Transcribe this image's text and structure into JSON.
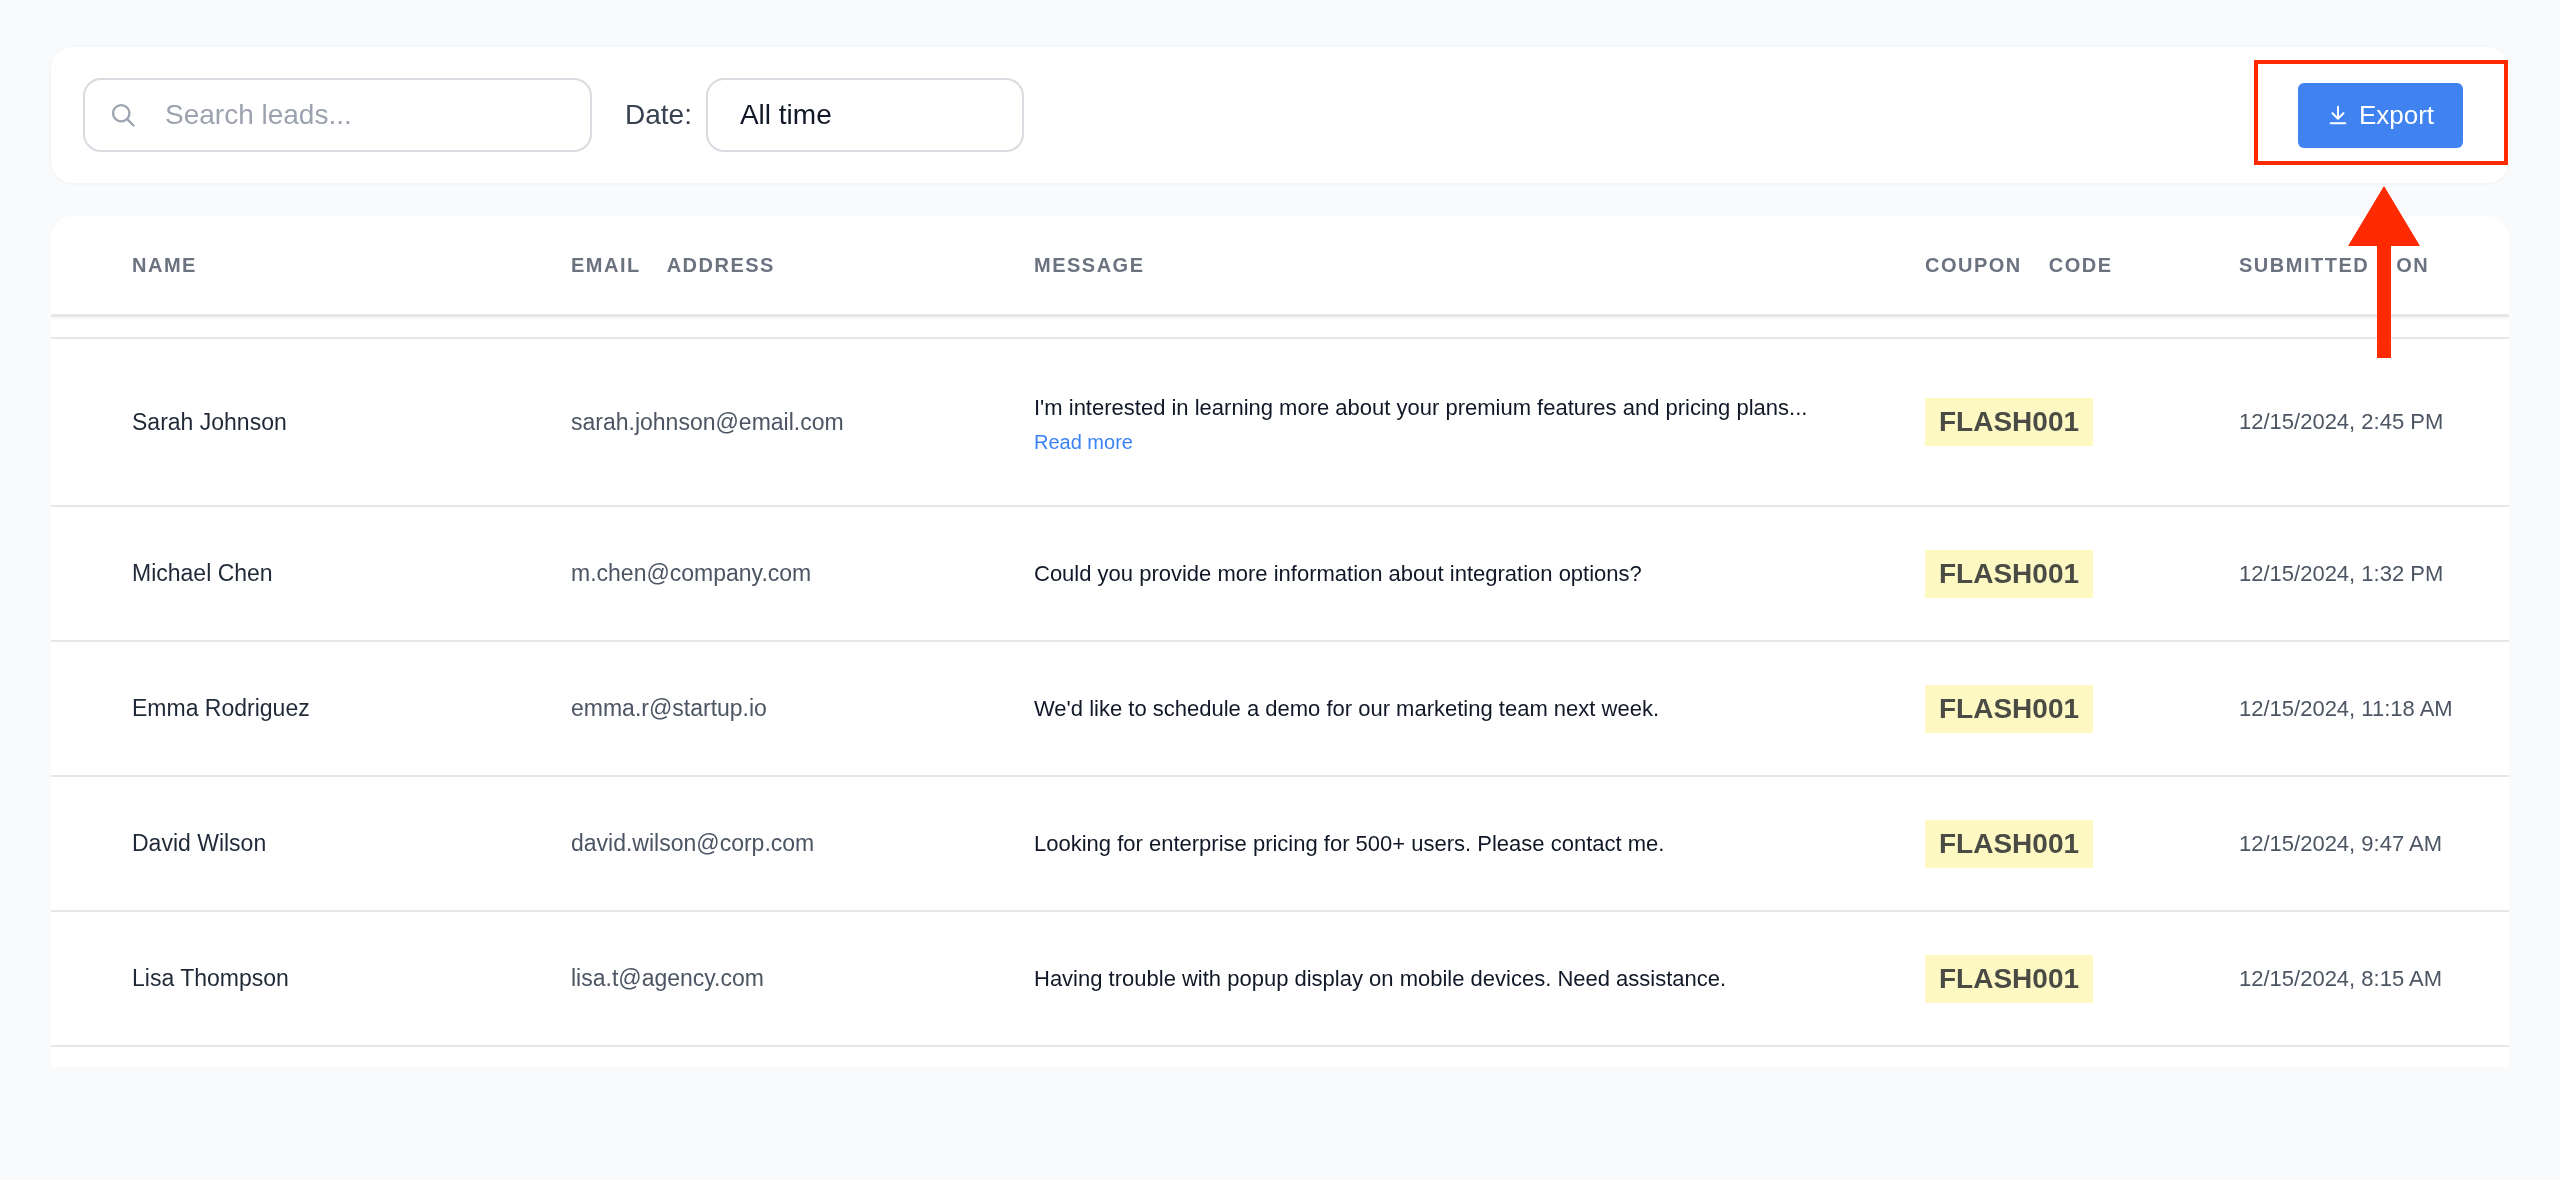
{
  "toolbar": {
    "search": {
      "placeholder": "Search leads..."
    },
    "date_filter": {
      "label": "Date:",
      "value": "All time"
    },
    "export_button": {
      "label": "Export"
    }
  },
  "table": {
    "columns": [
      "NAME",
      "EMAIL ADDRESS",
      "MESSAGE",
      "COUPON CODE",
      "SUBMITTED ON"
    ],
    "rows": [
      {
        "name": "Sarah Johnson",
        "email": "sarah.johnson@email.com",
        "message": "I'm interested in learning more about your premium features and pricing plans...",
        "read_more": "Read more",
        "coupon": "FLASH001",
        "submitted": "12/15/2024, 2:45 PM"
      },
      {
        "name": "Michael Chen",
        "email": "m.chen@company.com",
        "message": "Could you provide more information about integration options?",
        "coupon": "FLASH001",
        "submitted": "12/15/2024, 1:32 PM"
      },
      {
        "name": "Emma Rodriguez",
        "email": "emma.r@startup.io",
        "message": "We'd like to schedule a demo for our marketing team next week.",
        "coupon": "FLASH001",
        "submitted": "12/15/2024, 11:18 AM"
      },
      {
        "name": "David Wilson",
        "email": "david.wilson@corp.com",
        "message": "Looking for enterprise pricing for 500+ users. Please contact me.",
        "coupon": "FLASH001",
        "submitted": "12/15/2024, 9:47 AM"
      },
      {
        "name": "Lisa Thompson",
        "email": "lisa.t@agency.com",
        "message": "Having trouble with popup display on mobile devices. Need assistance.",
        "coupon": "FLASH001",
        "submitted": "12/15/2024, 8:15 AM"
      }
    ]
  }
}
